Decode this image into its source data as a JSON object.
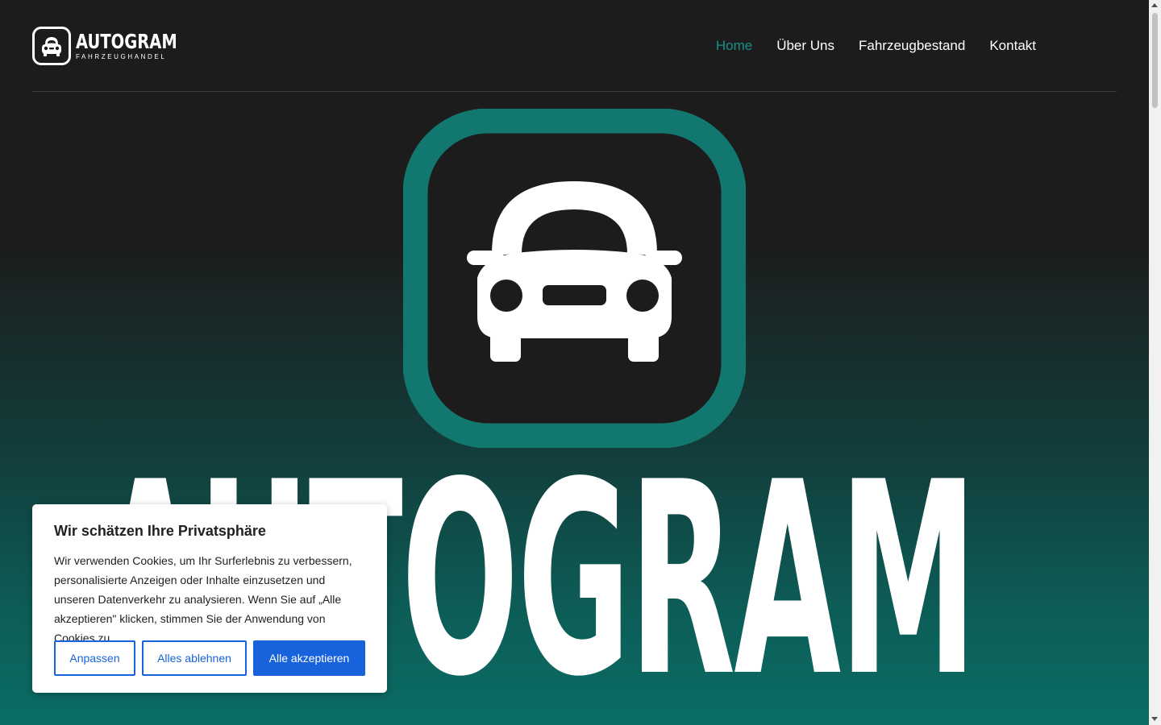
{
  "brand": {
    "name": "AUTOGRAM",
    "tagline": "FAHRZEUGHANDEL",
    "hero_word": "AUTOGRAM",
    "accent_color": "#12776f"
  },
  "nav": {
    "items": [
      {
        "label": "Home",
        "active": true
      },
      {
        "label": "Über Uns",
        "active": false
      },
      {
        "label": "Fahrzeugbestand",
        "active": false
      },
      {
        "label": "Kontakt",
        "active": false
      }
    ]
  },
  "cookie": {
    "title": "Wir schätzen Ihre Privatsphäre",
    "text": "Wir verwenden Cookies, um Ihr Surferlebnis zu verbessern, personalisierte Anzeigen oder Inhalte einzusetzen und unseren Datenverkehr zu analysieren. Wenn Sie auf „Alle akzeptieren\" klicken, stimmen Sie der Anwendung von Cookies zu.",
    "buttons": {
      "customize": "Anpassen",
      "reject": "Alles ablehnen",
      "accept": "Alle akzeptieren"
    },
    "button_color": "#1863dc"
  }
}
